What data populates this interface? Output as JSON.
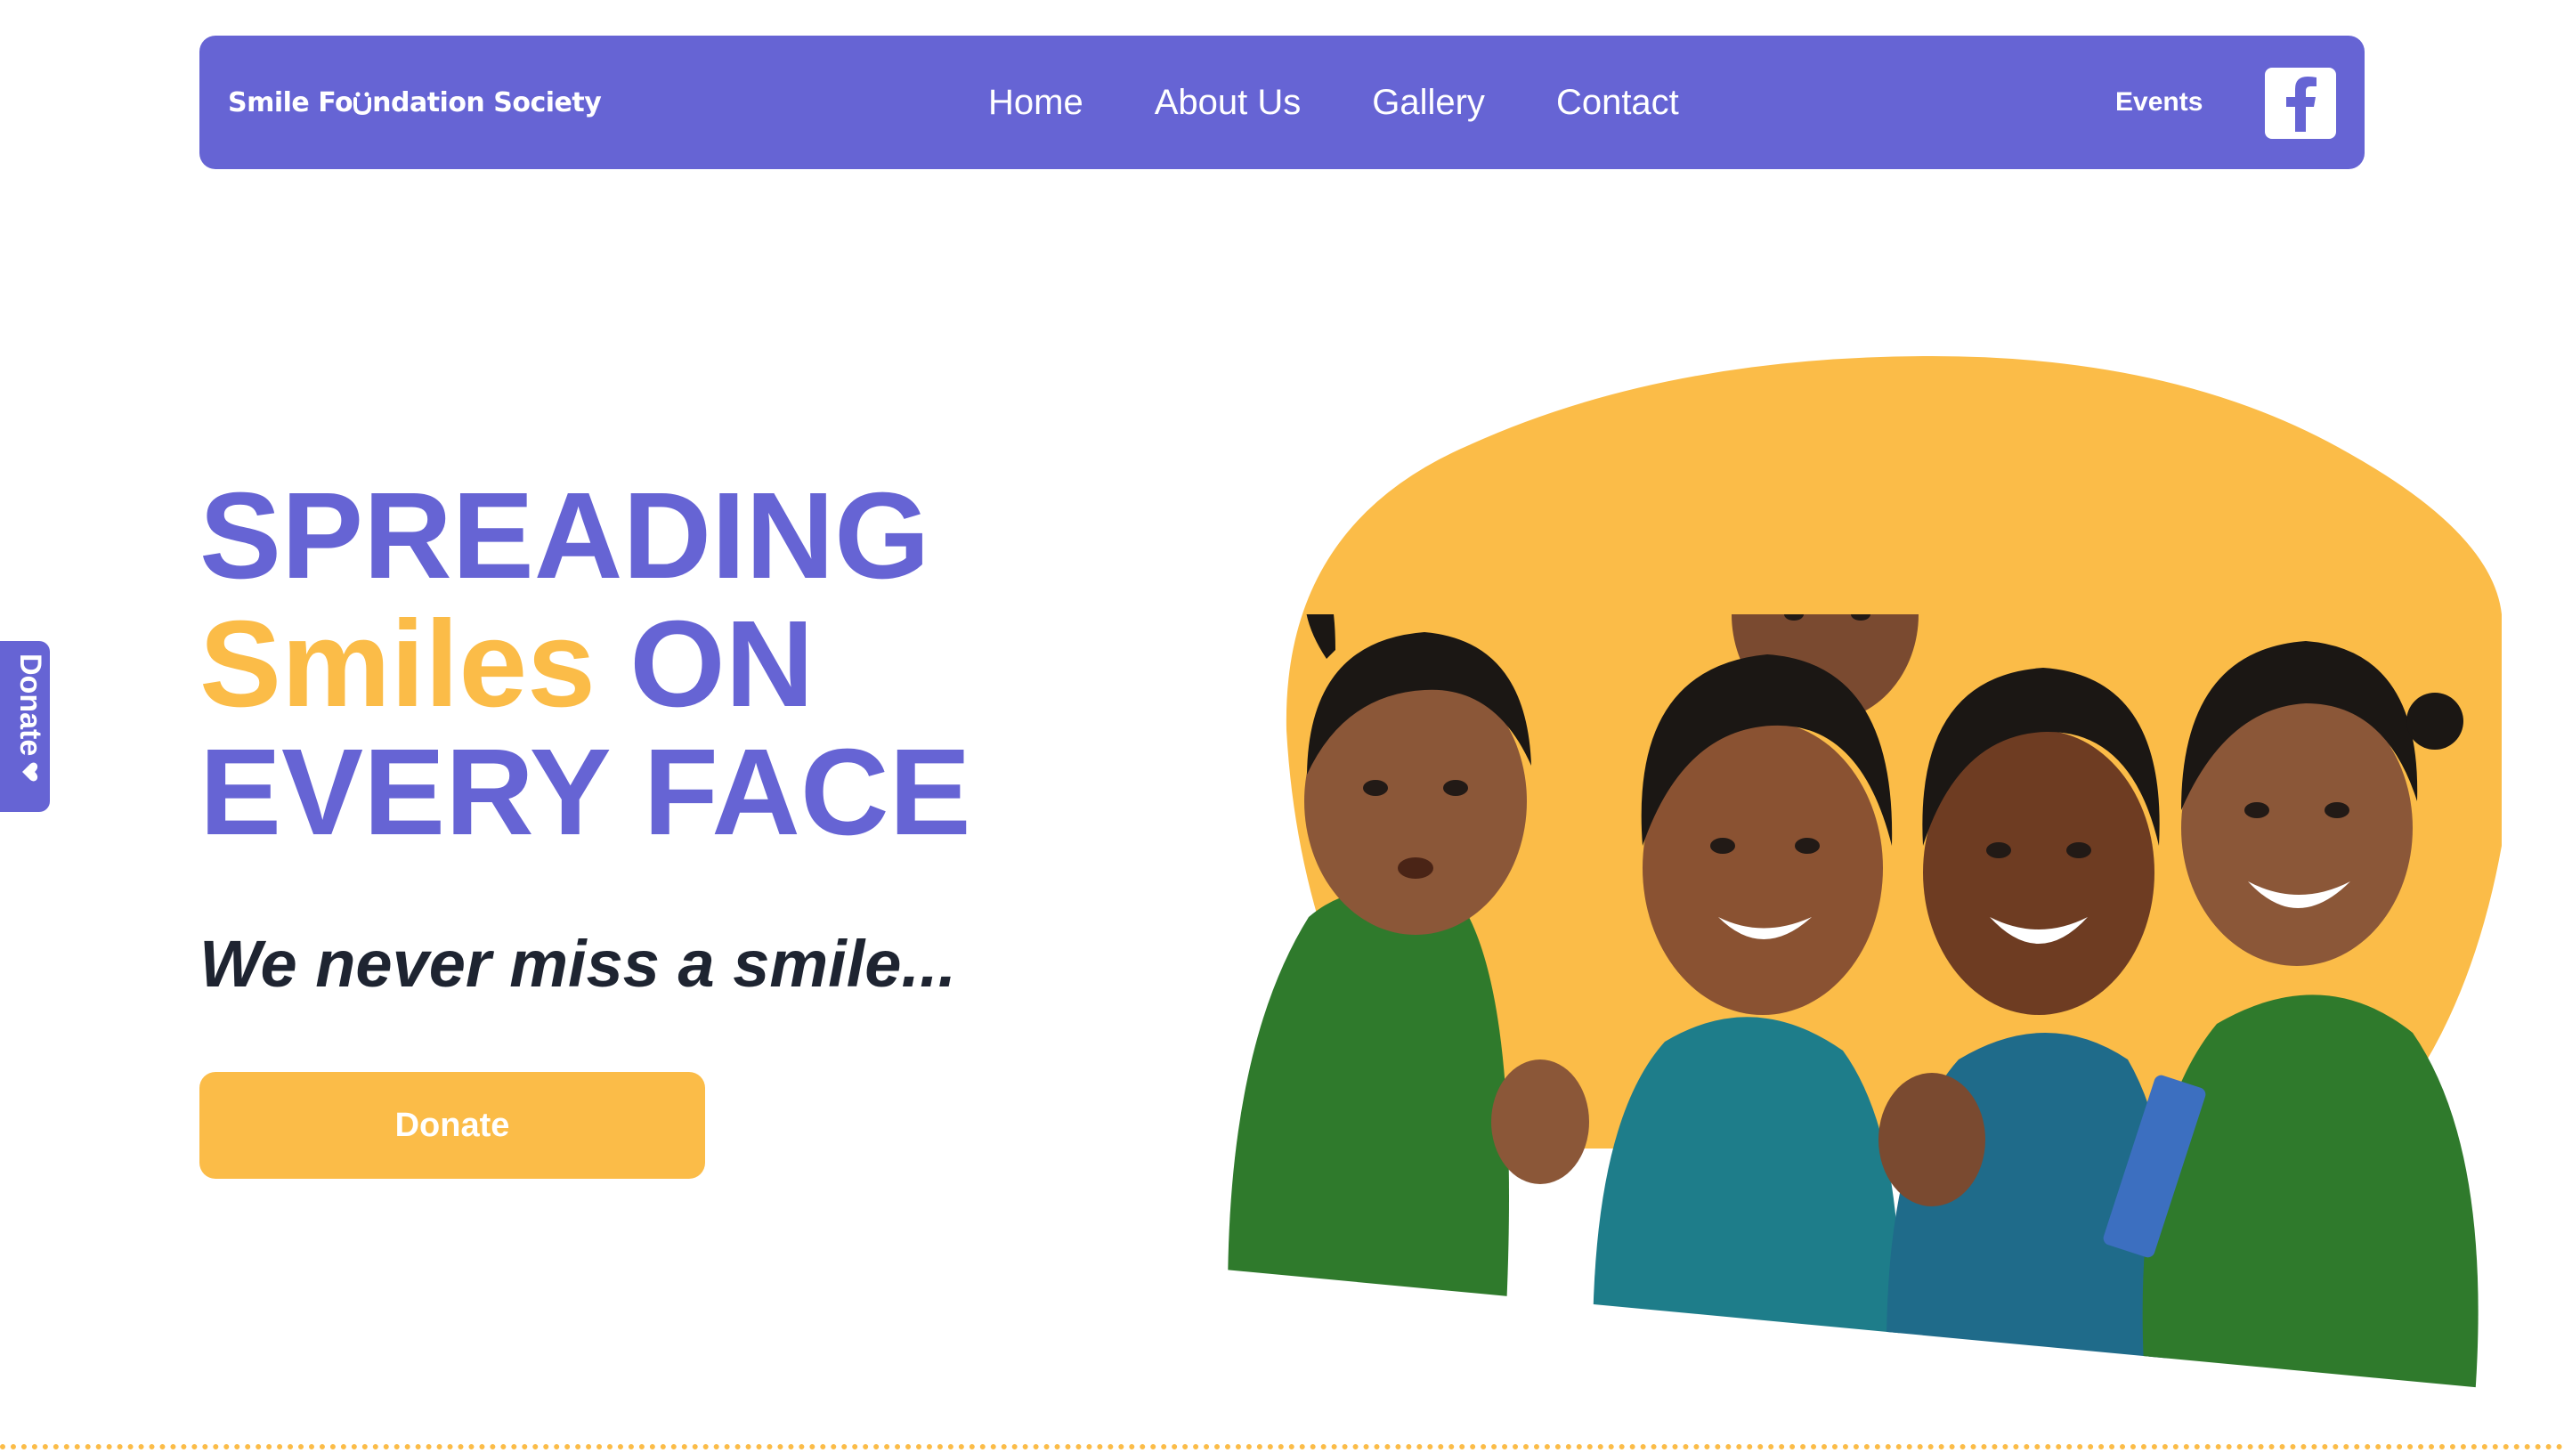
{
  "brand": {
    "name_part1": "Smile Fo",
    "name_part2": "ndation Society",
    "logo_icon": "smile-u-icon"
  },
  "nav": {
    "links": [
      {
        "label": "Home"
      },
      {
        "label": "About Us"
      },
      {
        "label": "Gallery"
      },
      {
        "label": "Contact"
      }
    ],
    "events_label": "Events",
    "social_icon": "facebook-icon"
  },
  "side_tab": {
    "label": "Donate",
    "icon": "heart-icon"
  },
  "hero": {
    "title_line1": "SPREADING",
    "title_accent": "Smiles",
    "title_line2_rest": " ON",
    "title_line3": "EVERY FACE",
    "tagline": "We never miss a smile...",
    "cta_label": "Donate",
    "image": "children-smiling-photo"
  },
  "colors": {
    "primary": "#6664d4",
    "accent": "#fbbc48",
    "text_dark": "#1e2431",
    "background": "#ffffff"
  }
}
